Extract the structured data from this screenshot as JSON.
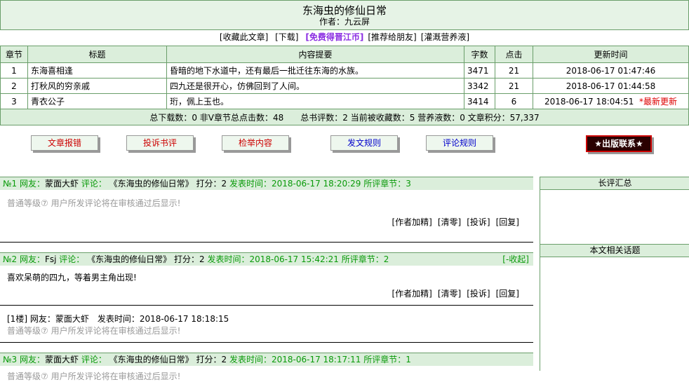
{
  "header": {
    "title": "东海虫的修仙日常",
    "author": "作者：九云屏"
  },
  "menu": {
    "fav": "[收藏此文章]",
    "download": "[下载]",
    "free": "[免费得晋江币]",
    "recommend": "[推荐给朋友]",
    "nutrient": "[灌溉营养液]"
  },
  "table": {
    "headers": [
      "章节",
      "标题",
      "内容提要",
      "字数",
      "点击",
      "更新时间"
    ],
    "rows": [
      {
        "no": "1",
        "title": "东海喜相逢",
        "summary": "昏暗的地下水道中，还有最后一批迁往东海的水族。",
        "words": "3471",
        "clicks": "21",
        "time": "2018-06-17 01:47:46",
        "tag": ""
      },
      {
        "no": "2",
        "title": "打秋风的穷亲戚",
        "summary": "四九还是很开心，仿佛回到了人间。",
        "words": "3342",
        "clicks": "21",
        "time": "2018-06-17 01:44:58",
        "tag": ""
      },
      {
        "no": "3",
        "title": "青衣公子",
        "summary": "珩，佩上玉也。",
        "words": "3414",
        "clicks": "6",
        "time": "2018-06-17 18:04:51",
        "tag": "*最新更新"
      }
    ],
    "summary": "总下载数：0 非V章节总点击数：48　　总书评数：2 当前被收藏数：5 营养液数：0 文章积分：57,337"
  },
  "buttons": {
    "report_chapter": "文章报错",
    "report_review": "投诉书评",
    "report_content": "检举内容",
    "post_rules": "发文规则",
    "review_rules": "评论规则",
    "publish": "★出版联系★"
  },
  "comments": [
    {
      "no": "№1",
      "label_user": "网友：",
      "user": "蒙面大虾",
      "label_review": "评论：",
      "book": "《东海虫的修仙日常》",
      "score": "打分：2",
      "time": "发表时间：2018-06-17 18:20:29",
      "chapter": "所评章节：3",
      "body_gray": "普通等级⑦ 用户所发评论将在审核通过后显示!",
      "body": ""
    },
    {
      "no": "№2",
      "label_user": "网友：",
      "user": "Fsj",
      "label_review": "评论：",
      "book": "《东海虫的修仙日常》",
      "score": "打分：2",
      "time": "发表时间：2018-06-17 15:42:21",
      "chapter": "所评章节：2",
      "fold": "[-收起]",
      "body": "喜欢呆萌的四九，等着男主角出现!",
      "reply_head": "[1楼] 网友：蒙面大虾　发表时间：2018-06-17 18:18:15",
      "reply_gray": "普通等级⑦ 用户所发评论将在审核通过后显示!"
    },
    {
      "no": "№3",
      "label_user": "网友：",
      "user": "蒙面大虾",
      "label_review": "评论：",
      "book": "《东海虫的修仙日常》",
      "score": "打分：2",
      "time": "发表时间：2018-06-17 18:17:11",
      "chapter": "所评章节：1",
      "body_gray": "普通等级⑦ 用户所发评论将在审核通过后显示!"
    }
  ],
  "actions": {
    "author_mark": "[作者加精]",
    "clear": "[清零]",
    "complain": "[投诉]",
    "reply": "[回复]"
  },
  "sidebar": {
    "long_reviews": "长评汇总",
    "topics": "本文相关话题"
  }
}
